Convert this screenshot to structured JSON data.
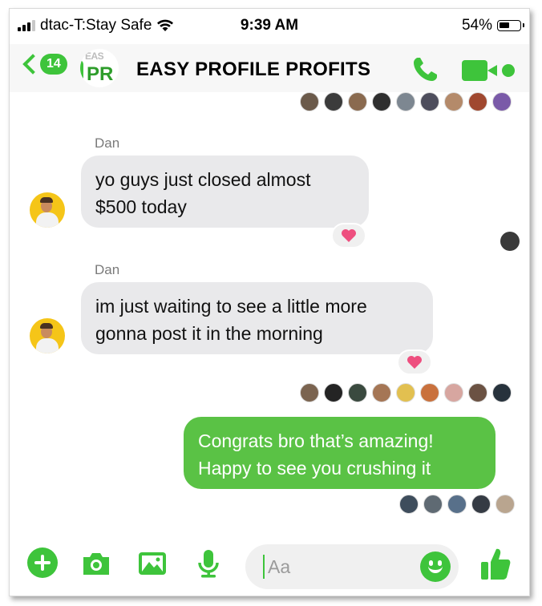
{
  "status_bar": {
    "carrier": "dtac-T:Stay Safe",
    "time": "9:39 AM",
    "battery": "54%",
    "battery_level": 0.54
  },
  "header": {
    "back_count": "14",
    "group_avatar_line1": "EAS",
    "group_avatar_line2": "PR",
    "title": "EASY PROFILE PROFITS",
    "accent_color": "#3ec43b"
  },
  "receipts_top": [
    "#6b5a4a",
    "#3b3b3b",
    "#8a6a4f",
    "#2f2f2f",
    "#7d8791",
    "#4d4d5c",
    "#b48a6a",
    "#a0482f",
    "#7a5aa8"
  ],
  "messages": [
    {
      "sender": "Dan",
      "text_lines": [
        "yo guys just closed almost",
        "$500 today"
      ],
      "reaction": "heart"
    },
    {
      "sender": "Dan",
      "text_lines": [
        "im just waiting to see a little more",
        "gonna post it in the morning"
      ],
      "reaction": "heart"
    },
    {
      "sender": "me",
      "text_lines": [
        "Congrats bro that’s amazing!",
        "Happy to see you crushing it"
      ],
      "bubble_color": "#5ac245"
    }
  ],
  "receipts_mid": [
    "#7b6450",
    "#242424",
    "#3a4a3f",
    "#a57655",
    "#e2c050",
    "#c9713d",
    "#d7a6a0",
    "#6b5243",
    "#27323c"
  ],
  "receipts_bottom": [
    "#3e4d5c",
    "#5f6a73",
    "#58708a",
    "#353b44",
    "#b9a58f"
  ],
  "composer": {
    "placeholder": "Aa",
    "icons": [
      "plus-icon",
      "camera-icon",
      "image-icon",
      "microphone-icon",
      "emoji-icon",
      "thumbs-up-icon"
    ]
  }
}
